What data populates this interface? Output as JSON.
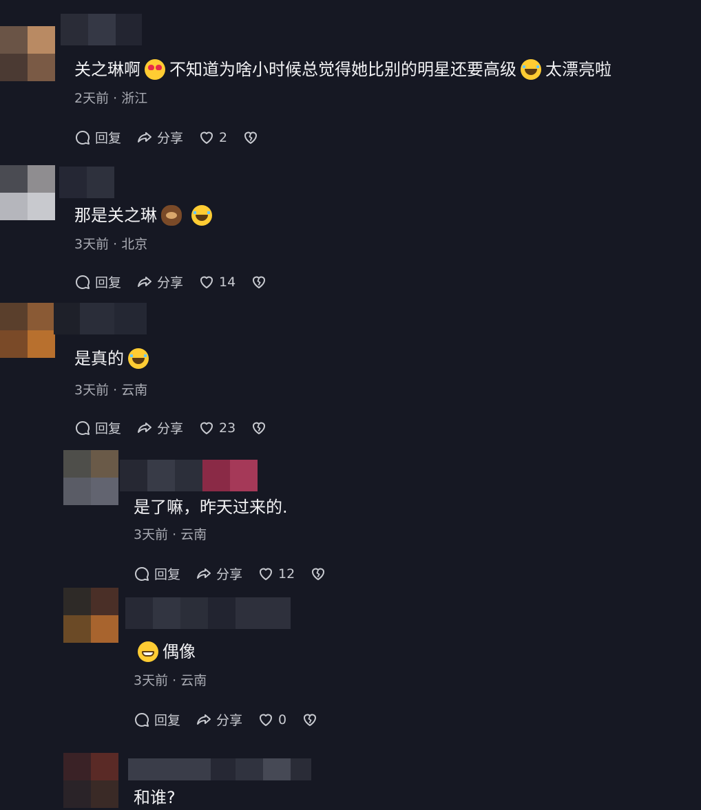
{
  "labels": {
    "reply": "回复",
    "share": "分享"
  },
  "comments": [
    {
      "text_before": "关之琳啊",
      "emoji1": "heart-eyes",
      "text_mid": "不知道为啥小时候总觉得她比别的明星还要高级",
      "emoji2": "laugh",
      "text_after": "太漂亮啦",
      "time": "2天前 · 浙江",
      "likes": "2"
    },
    {
      "text_before": "那是关之琳",
      "emoji1": "coffee",
      "emoji2": "laugh",
      "time": "3天前 · 北京",
      "likes": "14"
    },
    {
      "text_before": "是真的",
      "emoji1": "laugh",
      "time": "3天前 · 云南",
      "likes": "23"
    },
    {
      "text_before": "是了嘛，昨天过来的.",
      "time": "3天前 · 云南",
      "likes": "12"
    },
    {
      "emoji1": "grin",
      "text_after": "偶像",
      "time": "3天前 · 云南",
      "likes": "0"
    },
    {
      "text_before": "和谁?"
    }
  ]
}
